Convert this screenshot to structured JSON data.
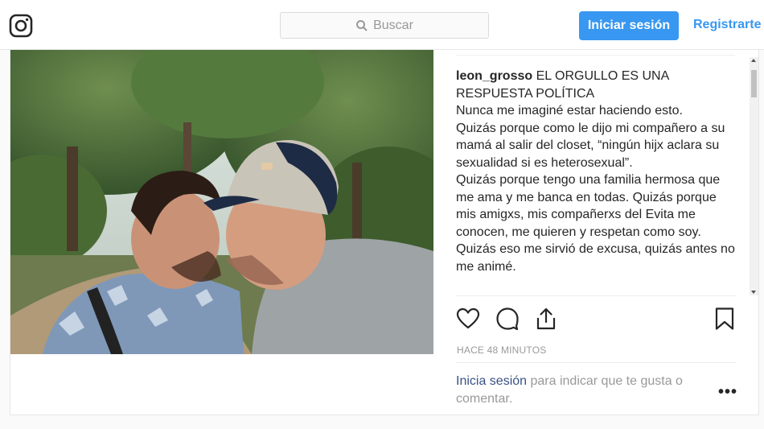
{
  "header": {
    "logo_icon": "instagram-logo-icon",
    "search_icon": "search-icon",
    "search_placeholder": "Buscar",
    "login_button": "Iniciar sesión",
    "register_link": "Registrarte",
    "accent_color": "#3897f0"
  },
  "post": {
    "photo_icon": "photo",
    "caption": {
      "username": "leon_grosso",
      "title_text": "EL ORGULLO ES UNA RESPUESTA POLÍTICA",
      "lines": [
        "Nunca me imaginé estar haciendo esto.",
        "Quizás porque como le dijo mi compañero a su mamá al salir del closet, “ningún hijx aclara su sexualidad si es heterosexual”.",
        "Quizás porque tengo una familia hermosa que me ama y me banca en todas. Quizás porque mis amigxs, mis compañerxs del Evita me conocen, me quieren y respetan como soy.",
        "Quizás eso me sirvió de excusa, quizás antes no me animé."
      ]
    },
    "actions": {
      "like_icon": "heart-icon",
      "comment_icon": "comment-icon",
      "share_icon": "share-icon",
      "save_icon": "bookmark-icon"
    },
    "timestamp": "HACE 48 MINUTOS",
    "login_prompt": {
      "link_text": "Inicia sesión",
      "rest_text": " para indicar que te gusta o comentar."
    },
    "more_label": "•••"
  }
}
